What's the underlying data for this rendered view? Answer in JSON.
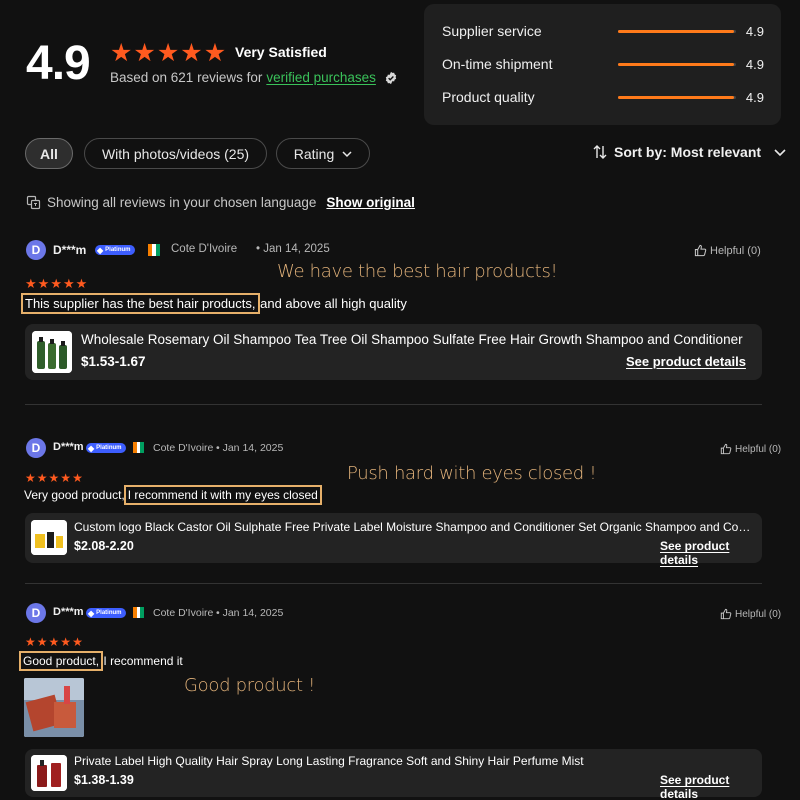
{
  "summary": {
    "score": "4.9",
    "stars": 5,
    "label": "Very Satisfied",
    "based_prefix": "Based on 621 reviews for",
    "verified_link": "verified purchases"
  },
  "metrics": [
    {
      "label": "Supplier service",
      "value": "4.9",
      "level": 0.98
    },
    {
      "label": "On-time shipment",
      "value": "4.9",
      "level": 0.98
    },
    {
      "label": "Product quality",
      "value": "4.9",
      "level": 0.98
    }
  ],
  "filters": {
    "all": "All",
    "photos": "With photos/videos (25)",
    "rating": "Rating",
    "sort": "Sort by: Most relevant"
  },
  "language_note": {
    "text": "Showing all reviews in your chosen language",
    "link": "Show original"
  },
  "reviews": [
    {
      "avatar": "D",
      "user": "D***m",
      "badge": "Platinum",
      "country": "Cote D'Ivoire",
      "date": "• Jan 14, 2025",
      "helpful": "Helpful (0)",
      "stars": 5,
      "text_highlight": "This supplier has the best hair products,",
      "text_rest": " and above all high quality",
      "annotation": "We have the best hair products!",
      "product": {
        "title": "Wholesale Rosemary Oil Shampoo Tea Tree Oil Shampoo Sulfate Free Hair Growth Shampoo and Conditioner",
        "price": "$1.53-1.67",
        "details": "See product details"
      }
    },
    {
      "avatar": "D",
      "user": "D***m",
      "badge": "Platinum",
      "country": "Cote D'Ivoire",
      "date": "• Jan 14, 2025",
      "helpful": "Helpful (0)",
      "stars": 5,
      "text_pre": "Very good product,",
      "text_highlight": "I recommend it with my eyes closed",
      "annotation": "Push hard with eyes closed !",
      "product": {
        "title": "Custom logo Black Castor Oil Sulphate Free Private Label Moisture Shampoo and Conditioner Set Organic Shampoo and Conditioner",
        "price": "$2.08-2.20",
        "details": "See product details"
      }
    },
    {
      "avatar": "D",
      "user": "D***m",
      "badge": "Platinum",
      "country": "Cote D'Ivoire",
      "date": "• Jan 14, 2025",
      "helpful": "Helpful (0)",
      "stars": 5,
      "text_highlight": "Good product,",
      "text_rest": " I recommend it",
      "annotation": "Good product !",
      "product": {
        "title": "Private Label High Quality Hair Spray Long Lasting Fragrance Soft and Shiny Hair Perfume Mist",
        "price": "$1.38-1.39",
        "details": "See product details"
      }
    }
  ],
  "colors": {
    "star": "#ff5a1f",
    "verified": "#3ac25a",
    "highlight_box": "#e6b06a",
    "annotation": "#e2b27a",
    "avatar": "#6c77e8"
  }
}
